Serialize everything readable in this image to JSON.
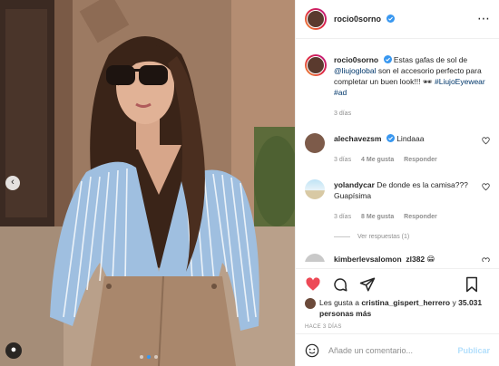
{
  "post": {
    "username": "rocio0sorno",
    "more_icon": "more-icon",
    "caption_user": "rocio0sorno",
    "caption_text_1": "Estas gafas de sol de",
    "caption_mention": "@liujoglobal",
    "caption_text_2": "son el accesorio perfecto para completar un buen look!!! 🕶",
    "caption_hashtag_1": "#LiujoEyewear",
    "caption_hashtag_2": "#ad",
    "caption_time": "3 días"
  },
  "comments": [
    {
      "user": "alechavezsm",
      "text": "Lindaaa",
      "time": "3 días",
      "likes": "4 Me gusta",
      "reply": "Responder"
    },
    {
      "user": "yolandycar",
      "text": "De donde es la camisa??? Guapísima",
      "time": "3 días",
      "likes": "8 Me gusta",
      "reply": "Responder",
      "view_replies": "Ver respuestas (1)"
    },
    {
      "user": "kimberleysalomon_zl382",
      "emoji": "😁"
    }
  ],
  "likes": {
    "prefix": "Les gusta a",
    "user": "cristina_gispert_herrero",
    "and": "y",
    "count": "35.031 personas más"
  },
  "time_ago": "HACE 3 DÍAS",
  "comment_input": {
    "placeholder": "Añade un comentario..."
  },
  "publish_label": "Publicar",
  "colors": {
    "like_red": "#ed4956",
    "link": "#00376b",
    "muted": "#8e8e8e",
    "accent": "#3897f0"
  }
}
